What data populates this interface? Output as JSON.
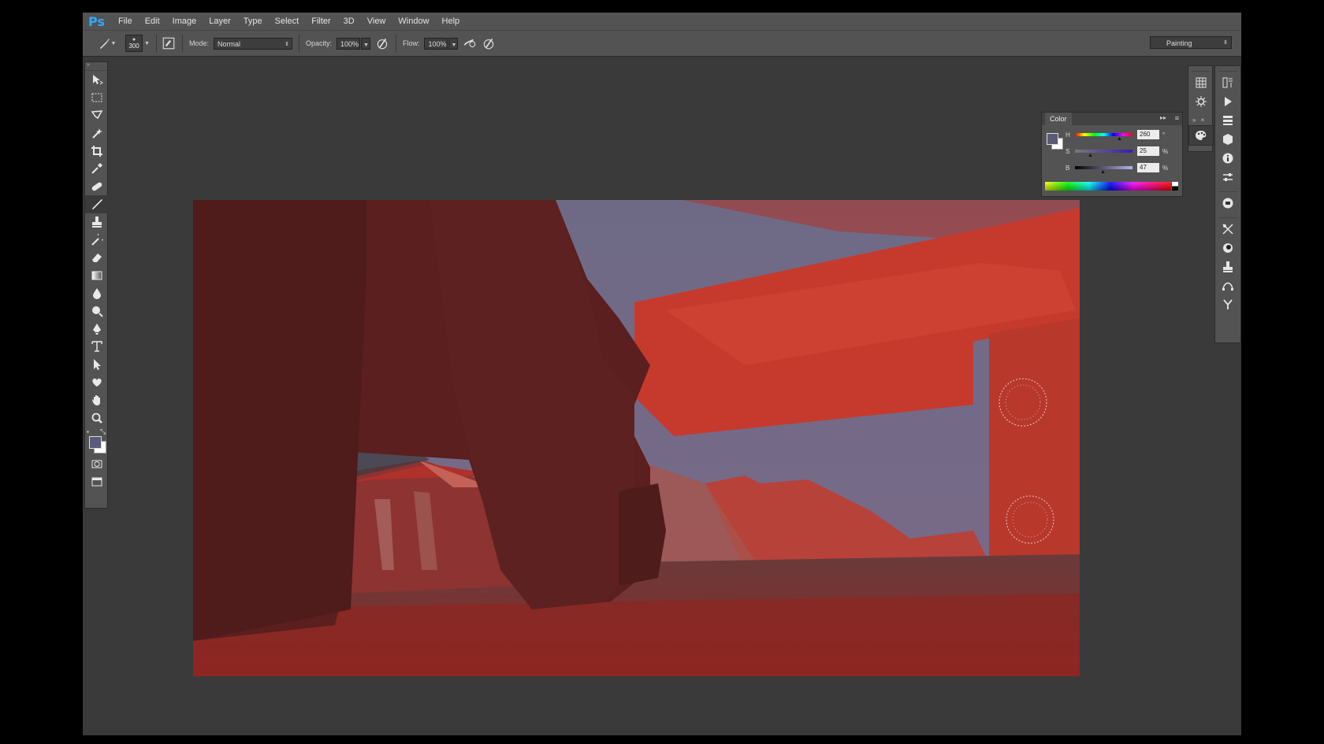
{
  "app": {
    "logo": "Ps",
    "menu": [
      "File",
      "Edit",
      "Image",
      "Layer",
      "Type",
      "Select",
      "Filter",
      "3D",
      "View",
      "Window",
      "Help"
    ]
  },
  "options_bar": {
    "brush_size": "300",
    "mode_label": "Mode:",
    "mode_value": "Normal",
    "opacity_label": "Opacity:",
    "opacity_value": "100%",
    "flow_label": "Flow:",
    "flow_value": "100%",
    "workspace": "Painting"
  },
  "tools": [
    {
      "name": "move-tool",
      "icon": "move-icon"
    },
    {
      "name": "rectangular-marquee-tool",
      "icon": "marquee-icon"
    },
    {
      "name": "lasso-tool",
      "icon": "lasso-icon"
    },
    {
      "name": "magic-wand-tool",
      "icon": "magic-wand-icon"
    },
    {
      "name": "crop-tool",
      "icon": "crop-icon"
    },
    {
      "name": "eyedropper-tool",
      "icon": "eyedropper-icon"
    },
    {
      "name": "healing-brush-tool",
      "icon": "bandage-icon"
    },
    {
      "name": "brush-tool",
      "icon": "brush-icon"
    },
    {
      "name": "clone-stamp-tool",
      "icon": "stamp-icon"
    },
    {
      "name": "history-brush-tool",
      "icon": "history-brush-icon"
    },
    {
      "name": "eraser-tool",
      "icon": "eraser-icon"
    },
    {
      "name": "gradient-tool",
      "icon": "gradient-icon"
    },
    {
      "name": "blur-tool",
      "icon": "drop-icon"
    },
    {
      "name": "dodge-tool",
      "icon": "dodge-icon"
    },
    {
      "name": "pen-tool",
      "icon": "pen-icon"
    },
    {
      "name": "type-tool",
      "icon": "type-icon"
    },
    {
      "name": "path-selection-tool",
      "icon": "arrow-icon"
    },
    {
      "name": "custom-shape-tool",
      "icon": "shape-icon"
    },
    {
      "name": "hand-tool",
      "icon": "hand-icon"
    },
    {
      "name": "zoom-tool",
      "icon": "zoom-icon"
    }
  ],
  "color_panel": {
    "title": "Color",
    "h_label": "H",
    "h_value": "260",
    "h_unit": "°",
    "s_label": "S",
    "s_value": "25",
    "s_unit": "%",
    "b_label": "B",
    "b_value": "47",
    "b_unit": "%",
    "foreground_color": "#5b5a78",
    "background_color": "#ffffff"
  },
  "colors": {
    "ui_dark": "#3a3a3a",
    "ui_panel": "#535353",
    "accent": "#31a8ff"
  }
}
